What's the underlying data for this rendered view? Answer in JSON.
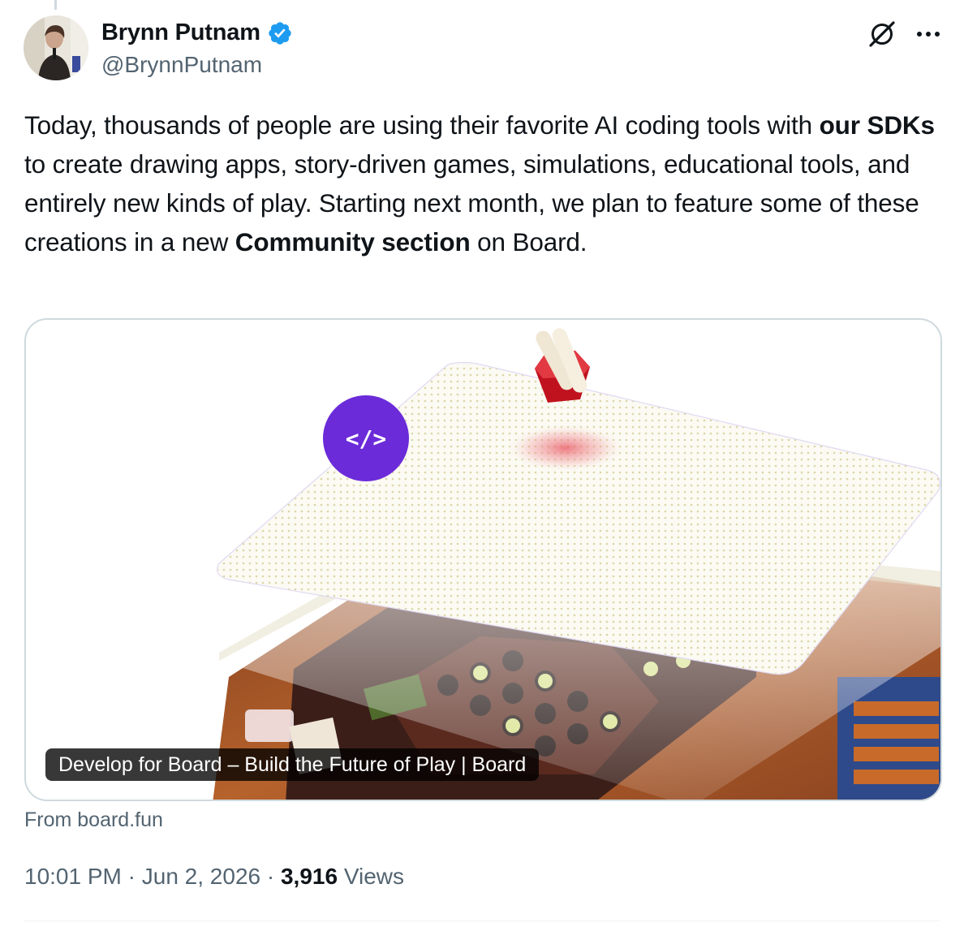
{
  "author": {
    "display_name": "Brynn Putnam",
    "handle": "@BrynnPutnam",
    "verified": true,
    "verified_color": "#1d9bf0"
  },
  "header_icons": {
    "grok": "grok-icon",
    "more": "more-icon"
  },
  "tweet": {
    "segments": [
      {
        "text": "Today, thousands of people are using their favorite AI coding tools with ",
        "bold": false
      },
      {
        "text": "our SDKs",
        "bold": true
      },
      {
        "text": " to create drawing apps, story-driven games, simulations, educational tools, and entirely new kinds of play. Starting next month, we plan to feature some of these creations in a new ",
        "bold": false
      },
      {
        "text": "Community section",
        "bold": true
      },
      {
        "text": " on Board.",
        "bold": false
      }
    ]
  },
  "card": {
    "caption": "Develop for Board – Build the Future of Play | Board",
    "code_badge": "</>",
    "source": "From board.fun",
    "accent": "#6b2bd9"
  },
  "meta": {
    "time": "10:01 PM",
    "separator": " · ",
    "date": "Jun 2, 2026",
    "views_count": "3,916",
    "views_label": " Views"
  }
}
